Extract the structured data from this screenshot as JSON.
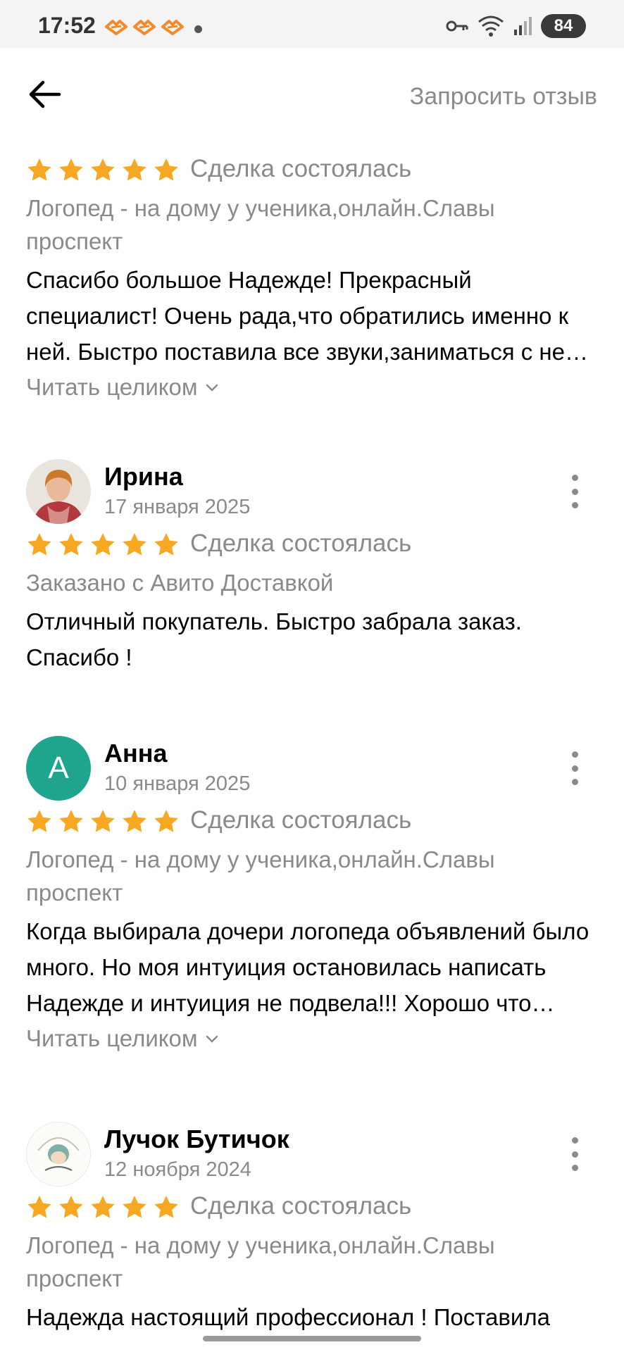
{
  "status_bar": {
    "time": "17:52",
    "battery": "84",
    "icons": [
      "notification-icon",
      "key-icon",
      "wifi-icon",
      "signal-icon"
    ]
  },
  "top_bar": {
    "back_icon": "arrow-left-icon",
    "request_review": "Запросить отзыв"
  },
  "colors": {
    "star": "#f7a823",
    "secondary_text": "#8a8a8a",
    "avatar_anna": "#1fa48e"
  },
  "reviews": [
    {
      "deal_status": "Сделка состоялась",
      "item": "Логопед - на дому у ученика,онлайн.Славы проспект",
      "text": "Спасибо большое Надежде! Прекрасный специалист! Очень рада,что обратились именно к ней. Быстро поставила все звуки,заниматься с ней одно удовольствие",
      "read_more": "Читать целиком"
    },
    {
      "author": "Ирина",
      "date": "17 января 2025",
      "deal_status": "Сделка состоялась",
      "item": "Заказано с Авито Доставкой",
      "text": "Отличный покупатель. Быстро забрала заказ. Спасибо !"
    },
    {
      "author": "Анна",
      "avatar_letter": "А",
      "date": "10 января 2025",
      "deal_status": "Сделка состоялась",
      "item": "Логопед - на дому у ученика,онлайн.Славы проспект",
      "text": "Когда  выбирала дочери логопеда объявлений было много. Но моя интуиция остановилась написать Надежде и интуиция не подвела!!! Хорошо что остановились на ней",
      "read_more": "Читать целиком"
    },
    {
      "author": "Лучок Бутичок",
      "date": "12 ноября 2024",
      "deal_status": "Сделка состоялась",
      "item": "Логопед - на дому у ученика,онлайн.Славы проспект",
      "text": "Надежда настоящий профессионал ! Поставила"
    }
  ]
}
